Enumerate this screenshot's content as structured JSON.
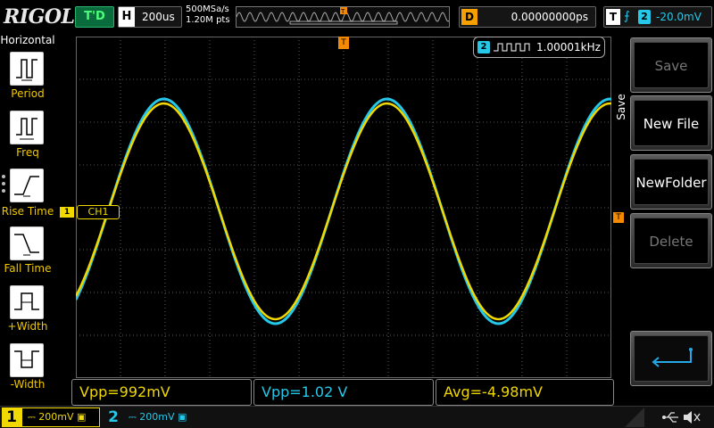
{
  "top": {
    "logo": "RIGOL",
    "run_state": "T'D",
    "timebase_label": "H",
    "timebase_value": "200us",
    "sample_rate": "500MSa/s",
    "memory_points": "1.20M pts",
    "delay_label": "D",
    "delay_value": "0.00000000ps",
    "trigger_label": "T",
    "trigger_channel": "2",
    "trigger_level": "-20.0mV"
  },
  "horizontal_menu": {
    "title": "Horizontal",
    "items": [
      {
        "label": "Period",
        "icon": "period-icon"
      },
      {
        "label": "Freq",
        "icon": "frequency-icon"
      },
      {
        "label": "Rise Time",
        "icon": "rise-time-icon"
      },
      {
        "label": "Fall Time",
        "icon": "fall-time-icon"
      },
      {
        "label": "+Width",
        "icon": "positive-width-icon"
      },
      {
        "label": "-Width",
        "icon": "negative-width-icon"
      }
    ]
  },
  "scope": {
    "ch1_marker": "1",
    "ch1_label": "CH1",
    "trigger_marker": "T",
    "freq_channel": "2",
    "freq_value": "1.00001kHz",
    "colors": {
      "ch1": "#f0d800",
      "ch2": "#25c8e8",
      "trigger": "#f58a00",
      "grid": "#5a5a5a"
    }
  },
  "measurements": [
    {
      "text": "Vpp=992mV",
      "color": "#f0d800"
    },
    {
      "text": "Vpp=1.02 V",
      "color": "#25c8e8"
    },
    {
      "text": "Avg=-4.98mV",
      "color": "#f0d800"
    }
  ],
  "save_menu": {
    "title": "Save",
    "buttons": [
      {
        "label": "Save",
        "enabled": false
      },
      {
        "label": "New File",
        "enabled": true
      },
      {
        "label": "NewFolder",
        "enabled": true
      },
      {
        "label": "Delete",
        "enabled": false
      }
    ],
    "back_icon": "return-arrow-icon"
  },
  "bottom": {
    "ch1_number": "1",
    "ch1_scale": "200mV",
    "ch2_number": "2",
    "ch2_scale": "200mV"
  }
}
